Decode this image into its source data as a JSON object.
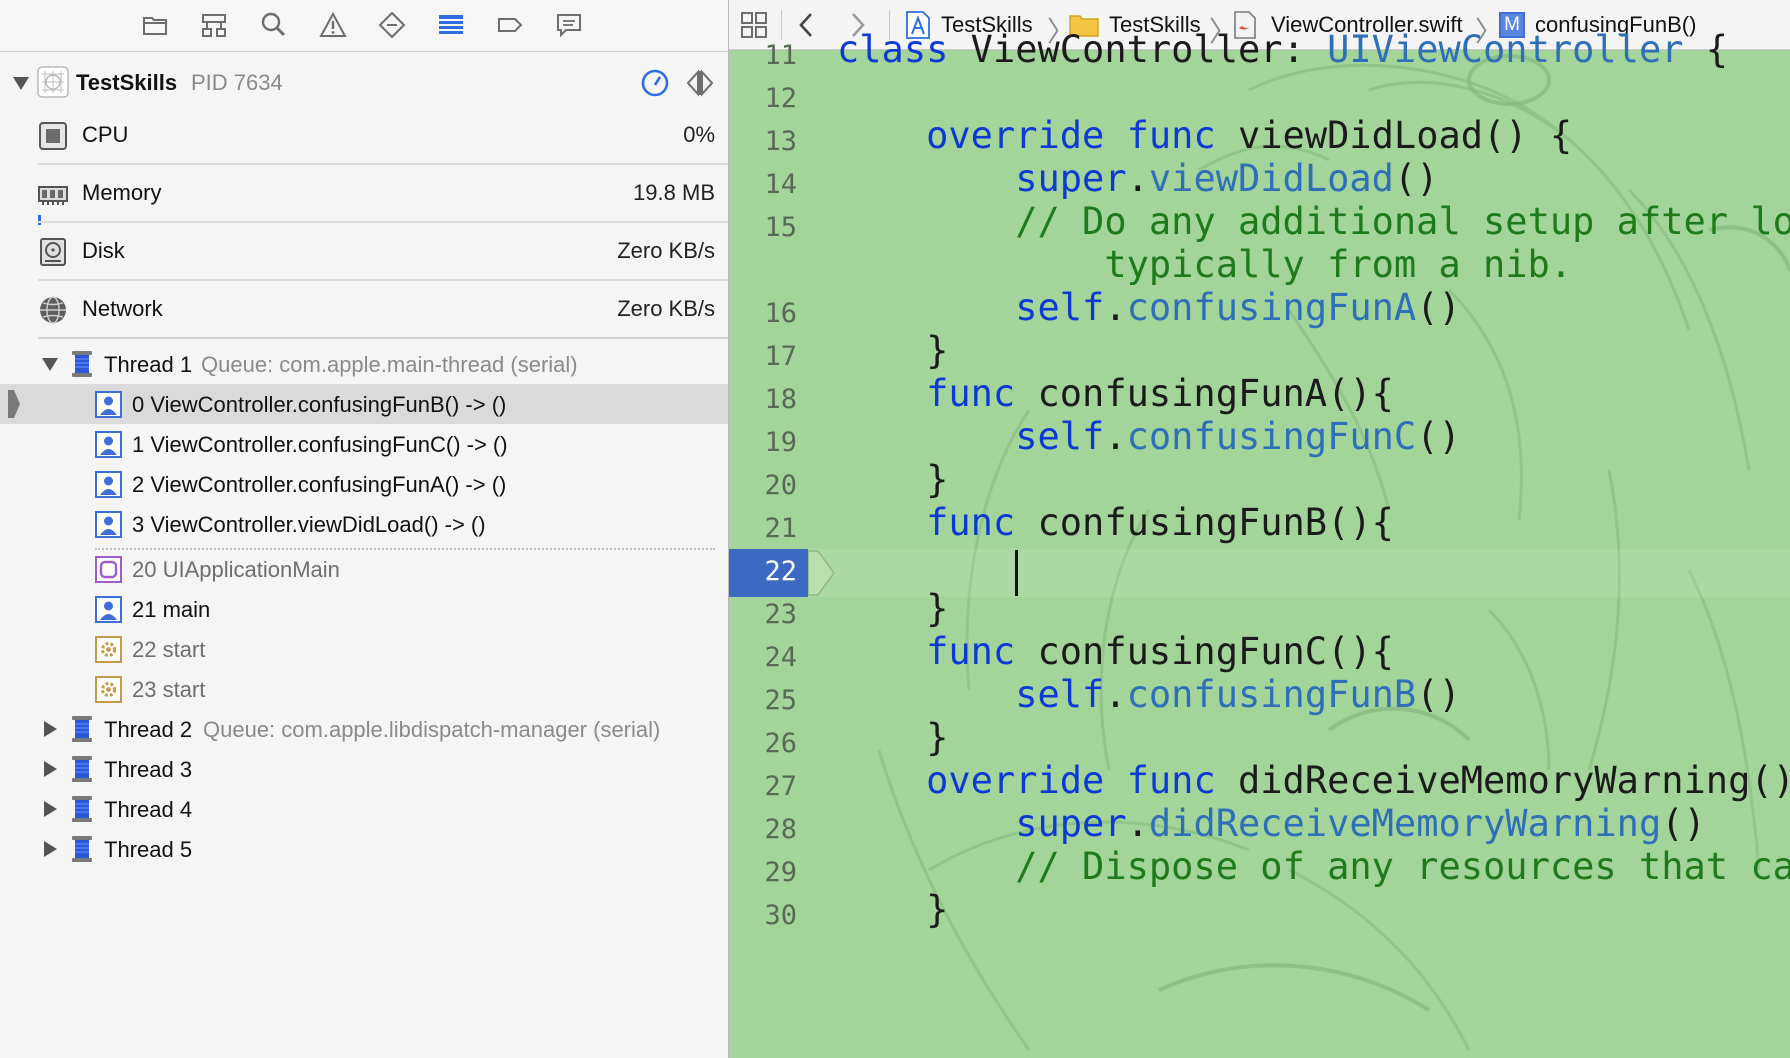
{
  "navigator": {
    "tabs": [
      {
        "name": "project-navigator-tab",
        "icon": "folder-icon",
        "active": false
      },
      {
        "name": "symbol-navigator-tab",
        "icon": "hierarchy-icon",
        "active": false
      },
      {
        "name": "find-navigator-tab",
        "icon": "magnifier-icon",
        "active": false
      },
      {
        "name": "issue-navigator-tab",
        "icon": "warning-triangle-icon",
        "active": false
      },
      {
        "name": "test-navigator-tab",
        "icon": "diamond-icon",
        "active": false
      },
      {
        "name": "debug-navigator-tab",
        "icon": "debug-list-icon",
        "active": true
      },
      {
        "name": "breakpoint-navigator-tab",
        "icon": "breakpoint-tag-icon",
        "active": false
      },
      {
        "name": "report-navigator-tab",
        "icon": "speech-bubble-icon",
        "active": false
      }
    ],
    "process": {
      "name": "TestSkills",
      "pid": "PID 7634"
    },
    "gauges": [
      {
        "label": "CPU",
        "value": "0%",
        "icon": "cpu-chip-icon"
      },
      {
        "label": "Memory",
        "value": "19.8 MB",
        "icon": "memory-module-icon",
        "fill": 0.01
      },
      {
        "label": "Disk",
        "value": "Zero KB/s",
        "icon": "hard-disk-icon"
      },
      {
        "label": "Network",
        "value": "Zero KB/s",
        "icon": "globe-network-icon"
      }
    ],
    "thread1": {
      "label": "Thread 1",
      "queue": "Queue: com.apple.main-thread (serial)"
    },
    "frames": [
      {
        "label": "0 ViewController.confusingFunB() -> ()",
        "icon": "user-frame-icon",
        "selected": true
      },
      {
        "label": "1 ViewController.confusingFunC() -> ()",
        "icon": "user-frame-icon"
      },
      {
        "label": "2 ViewController.confusingFunA() -> ()",
        "icon": "user-frame-icon"
      },
      {
        "label": "3 ViewController.viewDidLoad() -> ()",
        "icon": "user-frame-icon"
      },
      {
        "label": "20 UIApplicationMain",
        "icon": "framework-frame-icon"
      },
      {
        "label": "21 main",
        "icon": "user-frame-icon"
      },
      {
        "label": "22 start",
        "icon": "system-frame-icon"
      },
      {
        "label": "23 start",
        "icon": "system-frame-icon"
      }
    ],
    "other_threads": [
      {
        "label": "Thread 2",
        "queue": "Queue: com.apple.libdispatch-manager (serial)"
      },
      {
        "label": "Thread 3",
        "queue": ""
      },
      {
        "label": "Thread 4",
        "queue": ""
      },
      {
        "label": "Thread 5",
        "queue": ""
      }
    ]
  },
  "jump_bar": {
    "project": "TestSkills",
    "group": "TestSkills",
    "file": "ViewController.swift",
    "method_badge": "M",
    "method": "confusingFunB()"
  },
  "editor": {
    "current_line": "22",
    "lines": [
      {
        "n": "11",
        "tokens": [
          [
            "kw",
            "class"
          ],
          [
            "pl",
            " ViewController: "
          ],
          [
            "ty",
            "UIViewController"
          ],
          [
            "pl",
            " {"
          ]
        ]
      },
      {
        "n": "12",
        "tokens": []
      },
      {
        "n": "13",
        "tokens": [
          [
            "pl",
            "    "
          ],
          [
            "kw",
            "override"
          ],
          [
            "pl",
            " "
          ],
          [
            "kw",
            "func"
          ],
          [
            "pl",
            " viewDidLoad() {"
          ]
        ]
      },
      {
        "n": "14",
        "tokens": [
          [
            "pl",
            "        "
          ],
          [
            "kw",
            "super"
          ],
          [
            "pl",
            "."
          ],
          [
            "mt",
            "viewDidLoad"
          ],
          [
            "pl",
            "()"
          ]
        ]
      },
      {
        "n": "15",
        "tokens": [
          [
            "pl",
            "        "
          ],
          [
            "cm",
            "// Do any additional setup after loading the view,"
          ]
        ]
      },
      {
        "n": "",
        "tokens": [
          [
            "pl",
            "            "
          ],
          [
            "cm",
            "typically from a nib."
          ]
        ]
      },
      {
        "n": "16",
        "tokens": [
          [
            "pl",
            "        "
          ],
          [
            "kw",
            "self"
          ],
          [
            "pl",
            "."
          ],
          [
            "mt",
            "confusingFunA"
          ],
          [
            "pl",
            "()"
          ]
        ]
      },
      {
        "n": "17",
        "tokens": [
          [
            "pl",
            "    }"
          ]
        ]
      },
      {
        "n": "18",
        "tokens": [
          [
            "pl",
            "    "
          ],
          [
            "kw",
            "func"
          ],
          [
            "pl",
            " confusingFunA(){"
          ]
        ]
      },
      {
        "n": "19",
        "tokens": [
          [
            "pl",
            "        "
          ],
          [
            "kw",
            "self"
          ],
          [
            "pl",
            "."
          ],
          [
            "mt",
            "confusingFunC"
          ],
          [
            "pl",
            "()"
          ]
        ]
      },
      {
        "n": "20",
        "tokens": [
          [
            "pl",
            "    }"
          ]
        ]
      },
      {
        "n": "21",
        "tokens": [
          [
            "pl",
            "    "
          ],
          [
            "kw",
            "func"
          ],
          [
            "pl",
            " confusingFunB(){"
          ]
        ]
      },
      {
        "n": "22",
        "tokens": []
      },
      {
        "n": "23",
        "tokens": [
          [
            "pl",
            "    }"
          ]
        ]
      },
      {
        "n": "24",
        "tokens": [
          [
            "pl",
            "    "
          ],
          [
            "kw",
            "func"
          ],
          [
            "pl",
            " confusingFunC(){"
          ]
        ]
      },
      {
        "n": "25",
        "tokens": [
          [
            "pl",
            "        "
          ],
          [
            "kw",
            "self"
          ],
          [
            "pl",
            "."
          ],
          [
            "mt",
            "confusingFunB"
          ],
          [
            "pl",
            "()"
          ]
        ]
      },
      {
        "n": "26",
        "tokens": [
          [
            "pl",
            "    }"
          ]
        ]
      },
      {
        "n": "27",
        "tokens": [
          [
            "pl",
            "    "
          ],
          [
            "kw",
            "override"
          ],
          [
            "pl",
            " "
          ],
          [
            "kw",
            "func"
          ],
          [
            "pl",
            " didReceiveMemoryWarning() {"
          ]
        ]
      },
      {
        "n": "28",
        "tokens": [
          [
            "pl",
            "        "
          ],
          [
            "kw",
            "super"
          ],
          [
            "pl",
            "."
          ],
          [
            "mt",
            "didReceiveMemoryWarning"
          ],
          [
            "pl",
            "()"
          ]
        ]
      },
      {
        "n": "29",
        "tokens": [
          [
            "pl",
            "        "
          ],
          [
            "cm",
            "// Dispose of any resources that can be recreated."
          ]
        ]
      },
      {
        "n": "30",
        "tokens": [
          [
            "pl",
            "    }"
          ]
        ]
      }
    ]
  },
  "colors": {
    "editor_background": "#a3d49a",
    "keyword": "#0d3ad4",
    "type": "#2e6fb8",
    "comment": "#1e7a1b",
    "current_line_number_bg": "#3c69c2",
    "selected_row_bg": "#dadada"
  }
}
